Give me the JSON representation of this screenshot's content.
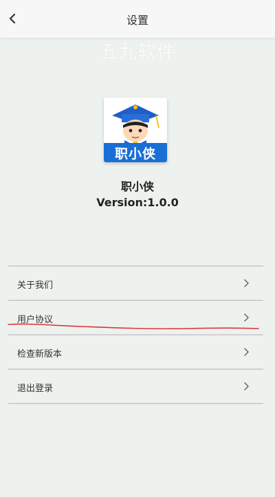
{
  "header": {
    "title": "设置",
    "back_icon": "chevron-left-icon"
  },
  "watermark": "五九软件",
  "app": {
    "logo_text": "职小侠",
    "name": "职小侠",
    "version": "Version:1.0.0"
  },
  "menu": {
    "items": [
      {
        "label": "关于我们",
        "icon": "chevron-right-icon"
      },
      {
        "label": "用户协议",
        "icon": "chevron-right-icon"
      },
      {
        "label": "检查新版本",
        "icon": "chevron-right-icon"
      },
      {
        "label": "退出登录",
        "icon": "chevron-right-icon"
      }
    ]
  },
  "colors": {
    "background": "#eef2ee",
    "logo_blue": "#1a6fd6",
    "annotation_red": "#e0333a"
  }
}
